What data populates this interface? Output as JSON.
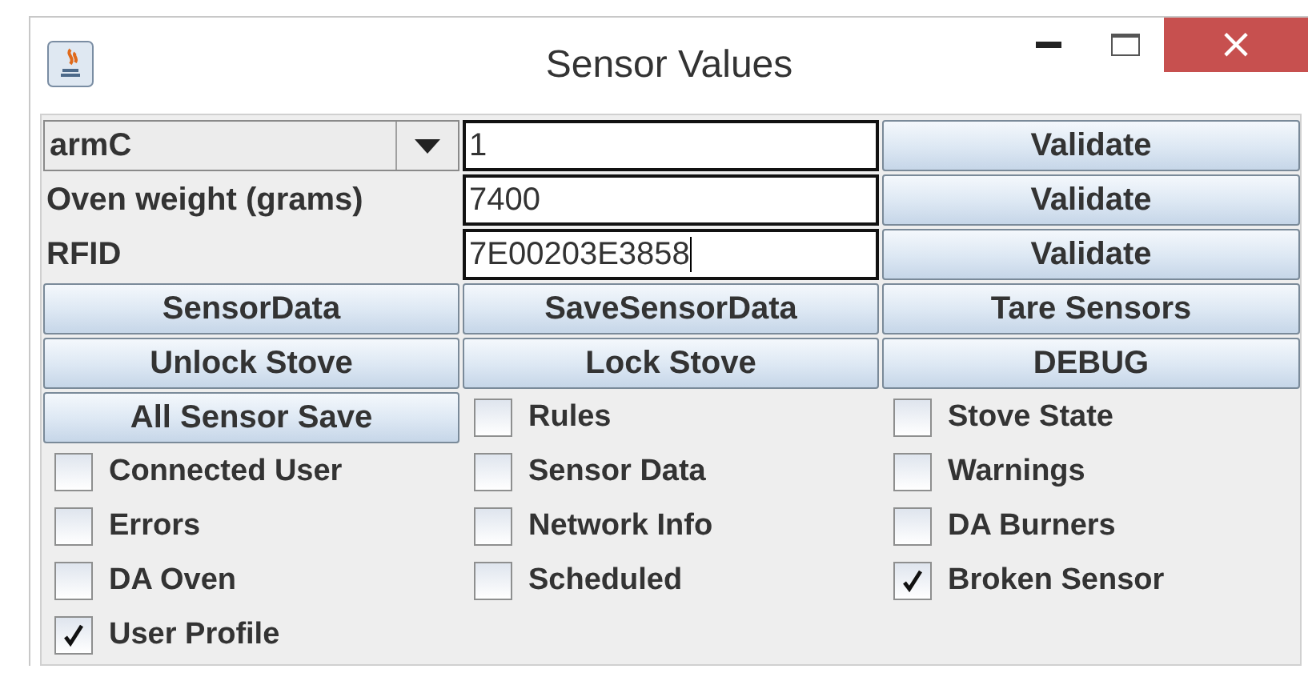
{
  "window": {
    "title": "Sensor Values",
    "close_glyph": "×"
  },
  "cells": [
    {
      "kind": "combo",
      "text": "armC"
    },
    {
      "kind": "field",
      "text": "1"
    },
    {
      "kind": "button",
      "text": "Validate"
    },
    {
      "kind": "label",
      "text": "Oven weight (grams)"
    },
    {
      "kind": "field",
      "text": "7400"
    },
    {
      "kind": "button",
      "text": "Validate"
    },
    {
      "kind": "label",
      "text": "RFID"
    },
    {
      "kind": "field",
      "text": "7E00203E3858"
    },
    {
      "kind": "button",
      "text": "Validate"
    },
    {
      "kind": "button",
      "text": "SensorData"
    },
    {
      "kind": "button",
      "text": "SaveSensorData"
    },
    {
      "kind": "button",
      "text": "Tare Sensors"
    },
    {
      "kind": "button",
      "text": "Unlock Stove"
    },
    {
      "kind": "button",
      "text": "Lock Stove"
    },
    {
      "kind": "button",
      "text": "DEBUG"
    },
    {
      "kind": "button",
      "text": "All Sensor Save"
    },
    {
      "kind": "checkbox",
      "text": "Rules",
      "checked": false
    },
    {
      "kind": "checkbox",
      "text": "Stove State",
      "checked": false
    },
    {
      "kind": "checkbox",
      "text": "Connected User",
      "checked": false
    },
    {
      "kind": "checkbox",
      "text": "Sensor Data",
      "checked": false
    },
    {
      "kind": "checkbox",
      "text": "Warnings",
      "checked": false
    },
    {
      "kind": "checkbox",
      "text": "Errors",
      "checked": false
    },
    {
      "kind": "checkbox",
      "text": "Network Info",
      "checked": false
    },
    {
      "kind": "checkbox",
      "text": "DA Burners",
      "checked": false
    },
    {
      "kind": "checkbox",
      "text": "DA Oven",
      "checked": false
    },
    {
      "kind": "checkbox",
      "text": "Scheduled",
      "checked": false
    },
    {
      "kind": "checkbox",
      "text": "Broken Sensor",
      "checked": true
    },
    {
      "kind": "checkbox",
      "text": "User Profile",
      "checked": true
    }
  ]
}
